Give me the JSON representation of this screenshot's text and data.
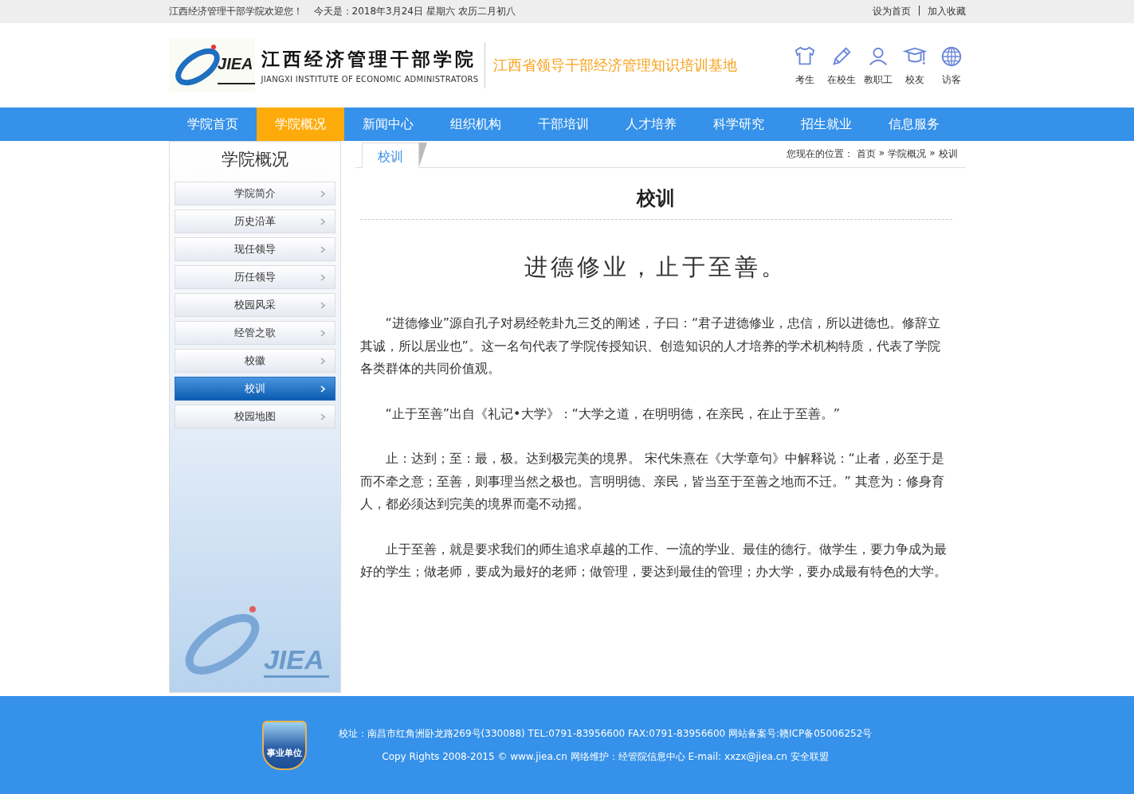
{
  "top_bar": {
    "welcome": "江西经济管理干部学院欢迎您！",
    "date": "今天是：2018年3月24日 星期六 农历二月初八",
    "links": [
      "设为首页",
      "加入收藏"
    ],
    "separator": "|"
  },
  "header": {
    "logo_mark": "JIEA",
    "name_cn": "江西经济管理干部学院",
    "name_en": "JIANGXI INSTITUTE OF ECONOMIC ADMINISTRATORS",
    "slogan": "江西省领导干部经济管理知识培训基地",
    "portals": [
      {
        "kind": "shirt",
        "label": "考生"
      },
      {
        "kind": "pencil",
        "label": "在校生"
      },
      {
        "kind": "person",
        "label": "教职工"
      },
      {
        "kind": "cap",
        "label": "校友"
      },
      {
        "kind": "globe",
        "label": "访客"
      }
    ]
  },
  "nav": [
    {
      "label": "学院首页",
      "selected": false
    },
    {
      "label": "学院概况",
      "selected": true
    },
    {
      "label": "新闻中心",
      "selected": false
    },
    {
      "label": "组织机构",
      "selected": false
    },
    {
      "label": "干部培训",
      "selected": false
    },
    {
      "label": "人才培养",
      "selected": false
    },
    {
      "label": "科学研究",
      "selected": false
    },
    {
      "label": "招生就业",
      "selected": false
    },
    {
      "label": "信息服务",
      "selected": false
    }
  ],
  "sidebar": {
    "title": "学院概况",
    "items": [
      {
        "label": "学院简介",
        "selected": false
      },
      {
        "label": "历史沿革",
        "selected": false
      },
      {
        "label": "现任领导",
        "selected": false
      },
      {
        "label": "历任领导",
        "selected": false
      },
      {
        "label": "校园风采",
        "selected": false
      },
      {
        "label": "经管之歌",
        "selected": false
      },
      {
        "label": "校徽",
        "selected": false
      },
      {
        "label": "校训",
        "selected": true
      },
      {
        "label": "校园地图",
        "selected": false
      }
    ],
    "logo_mark": "JIEA"
  },
  "content": {
    "tab": "校训",
    "breadcrumb": {
      "prefix": "您现在的位置：",
      "path": [
        "首页",
        "学院概况",
        "校训"
      ],
      "separator": "»"
    },
    "title": "校训",
    "motto": "进德修业，止于至善。",
    "paragraphs": [
      "“进德修业”源自孔子对易经乾卦九三爻的阐述，子曰：“君子进德修业，忠信，所以进德也。修辞立其诚，所以居业也”。这一名句代表了学院传授知识、创造知识的人才培养的学术机构特质，代表了学院各类群体的共同价值观。",
      "“止于至善”出自《礼记•大学》：“大学之道，在明明德，在亲民，在止于至善。”",
      "止：达到；至：最，极。达到极完美的境界。 宋代朱熹在《大学章句》中解释说：“止者，必至于是而不牵之意；至善，则事理当然之极也。言明明德、亲民，皆当至于至善之地而不迁。” 其意为：修身育人，都必须达到完美的境界而毫不动摇。",
      "止于至善，就是要求我们的师生追求卓越的工作、一流的学业、最佳的德行。做学生，要力争成为最好的学生；做老师，要成为最好的老师；做管理，要达到最佳的管理；办大学，要办成最有特色的大学。"
    ]
  },
  "footer": {
    "badge": "事业单位",
    "lines": [
      "校址：南昌市红角洲卧龙路269号(330088) TEL:0791-83956600 FAX:0791-83956600 网站备案号:赣ICP备05006252号",
      "Copy Rights 2008-2015 © www.jiea.cn 网络维护：经管院信息中心 E-mail: xxzx@jiea.cn 安全联盟"
    ]
  }
}
